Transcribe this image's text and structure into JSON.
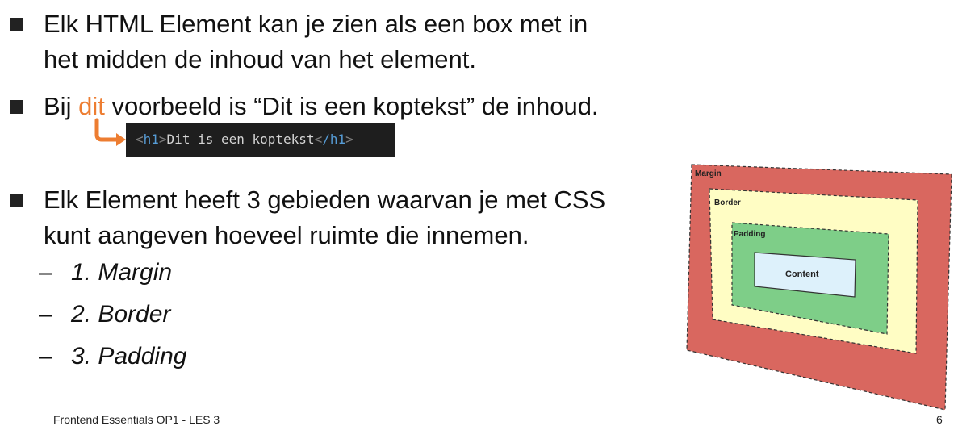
{
  "bullets": [
    {
      "line1": "Elk HTML Element kan je zien als een box met in",
      "line2": "het midden de inhoud van het element."
    },
    {
      "before": "Bij ",
      "highlight": "dit",
      "after": " voorbeeld is “Dit is een koptekst” de inhoud."
    },
    {
      "line1": "Elk Element heeft 3 gebieden waarvan je met CSS",
      "line2": "kunt aangeven hoeveel ruimte die innemen."
    }
  ],
  "subitems": [
    "1. Margin",
    "2. Border",
    "3. Padding"
  ],
  "code_example": {
    "open_tag": "h1",
    "text": "Dit is een koptekst",
    "close_tag": "/h1"
  },
  "box_model": {
    "margin_label": "Margin",
    "border_label": "Border",
    "padding_label": "Padding",
    "content_label": "Content"
  },
  "footer": {
    "course": "Frontend Essentials OP1 - LES 3",
    "page": "6"
  },
  "colors": {
    "accent": "#ED7D31",
    "margin": "#D9675F",
    "border": "#FFFDC4",
    "padding": "#7ECE88",
    "content": "#DDF1FB"
  }
}
